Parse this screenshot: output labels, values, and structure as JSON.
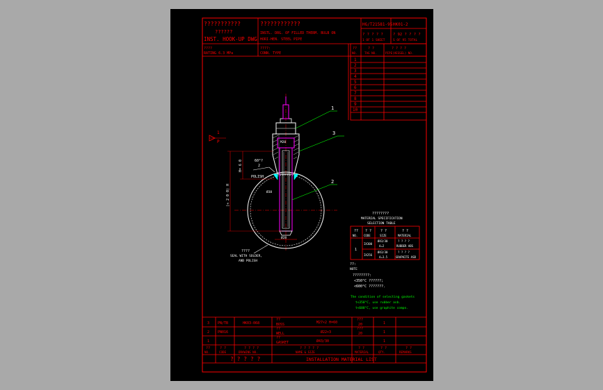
{
  "colors": {
    "frame": "#ff0000",
    "text_red": "#ff0000",
    "text_green": "#00ff00",
    "text_yellow": "#ffff00",
    "pipe": "#ffffff",
    "well": "#ff00ff",
    "leader": "#00ff00",
    "viewport_bg": "#000000",
    "app_bg": "#a9a9a9"
  },
  "title_block": {
    "left_l1": "???????????",
    "left_l2": "??????",
    "left_l3": "INST. HOOK-UP DWG",
    "mid_l1": "????????????",
    "mid_l2": "INSTL. DRG. OF FILLED THERM. BULB ON",
    "mid_l3": "HORI-HEN. STEEL PIPE",
    "std_no": "HG/T21581-95",
    "dwg_no": "HK01-2",
    "page_row1": "? ? ? ? ?",
    "page_row2": "1 OF 1 SHEET",
    "total_row1": "? 92 ? ? ? ?",
    "total_row2": "S OF 95 TOTAL"
  },
  "spec_row": {
    "rating_label": "????",
    "rating": "RATING  6.3 MPa",
    "conn_label": "????:",
    "conn": "CONN. TYPE"
  },
  "tag_table": {
    "header": [
      "??",
      "? ?",
      "? ? ? ?"
    ],
    "header_en": [
      "NO.",
      "TAG NO.",
      "PIPE(VESSEL) NO."
    ],
    "rows": [
      "1",
      "2",
      "3",
      "4",
      "5",
      "6",
      "7",
      "8",
      "9",
      "10"
    ]
  },
  "drawing": {
    "callouts": [
      "1",
      "2",
      "3"
    ],
    "view_mark": "1",
    "view_mark_p": "P",
    "dim_left": "(≈ 2 0 0) H",
    "dim_inner": "H= 6 0",
    "angle_label": "60°?",
    "angle_sub": "2",
    "polish_label": "POLISH",
    "m_label": "M20",
    "d_label": "Ø38",
    "bottom_dim": "Ø28",
    "seal_l1": "????",
    "seal_l2": "SEAL WITH SOLDER,",
    "seal_l3": "AND POLISH"
  },
  "material_spec": {
    "title_cn": "????????",
    "title_en1": "MATERIAL SPECIFICATION",
    "title_en2": "SELECTION TABLE",
    "headers": [
      "??",
      "? ?",
      "? ?",
      "? ?"
    ],
    "headers_en": [
      "NO.",
      "CODE",
      "SIZE",
      "MATERIAL"
    ],
    "row_no": "1",
    "codes": [
      "IX300",
      "IX256"
    ],
    "sizes_1": [
      "Ø43/30",
      "ő=2"
    ],
    "sizes_2": [
      "Ø43/30",
      "ő=3.5"
    ],
    "materials_1": [
      "? ? ? ?",
      "RUBBER ABS"
    ],
    "materials_2": [
      "? ? ? ?",
      "GRAPHITE ASB"
    ]
  },
  "notes": {
    "title_cn": "??:",
    "title_en": "NOTE",
    "l1": "????????:",
    "l2": "<350°C ??????;",
    "l3": "<600°C ???????.",
    "e1": "The condition of selecting gaskets",
    "e2": "t<350°C, use rubber asb.",
    "e3": "t<600°C, use graphite compo."
  },
  "bom": {
    "rows": [
      {
        "no": "3",
        "code": "PN/TB",
        "drawing": "HK03-068",
        "name_cn": "?? ",
        "name_en": "BOSS",
        "size": "M27×2  H=60",
        "mat_cn": "???",
        "mat_en": "20",
        "qty": "1",
        "remarks": ""
      },
      {
        "no": "2",
        "code": "PN016",
        "drawing": "",
        "name_cn": "??",
        "name_en": "WELL",
        "size": "Ø22×3",
        "mat_cn": "???",
        "mat_en": "20",
        "qty": "1",
        "remarks": ""
      },
      {
        "no": "1",
        "code": "",
        "drawing": "",
        "name_cn": "??",
        "name_en": "GASKET",
        "size": "Ø43/30",
        "mat_cn": "",
        "mat_en": "",
        "qty": "1",
        "remarks": ""
      }
    ],
    "header_cn": [
      "??",
      "? ?",
      "? ? ? ?",
      "? ? ? ? ?",
      "? ?",
      "? ?",
      "? ?"
    ],
    "header_en": [
      "NO.",
      "CODE",
      "DRAWING NO.",
      "NAME & SIZE",
      "MATERIAL",
      "QTY.",
      "REMARKS"
    ],
    "footer_cn": "? ? ? ? ?",
    "footer_en": "INSTALLATION MATERIAL LIST"
  }
}
